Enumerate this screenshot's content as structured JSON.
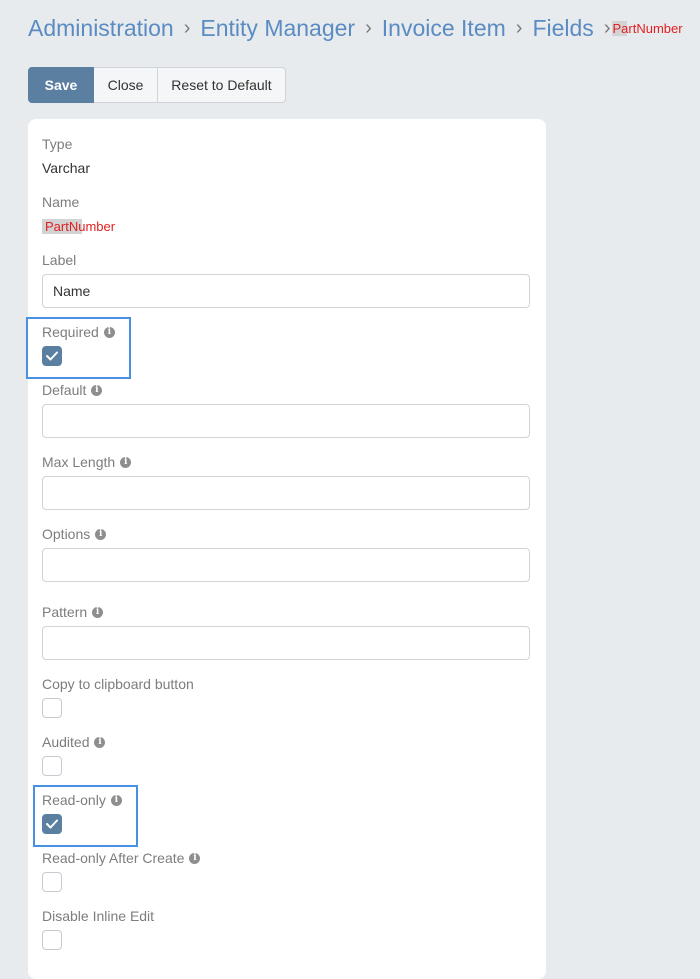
{
  "breadcrumb": {
    "items": [
      "Administration",
      "Entity Manager",
      "Invoice Item",
      "Fields"
    ],
    "current": "PartNumber"
  },
  "toolbar": {
    "save_label": "Save",
    "close_label": "Close",
    "reset_label": "Reset to Default"
  },
  "form": {
    "type": {
      "label": "Type",
      "value": "Varchar"
    },
    "name": {
      "label": "Name",
      "value": "PartNumber"
    },
    "label_field": {
      "label": "Label",
      "value": "Name"
    },
    "required": {
      "label": "Required",
      "checked": true
    },
    "default": {
      "label": "Default",
      "value": ""
    },
    "max_length": {
      "label": "Max Length",
      "value": ""
    },
    "options": {
      "label": "Options",
      "value": ""
    },
    "pattern": {
      "label": "Pattern",
      "value": ""
    },
    "copy_to_clipboard": {
      "label": "Copy to clipboard button",
      "checked": false
    },
    "audited": {
      "label": "Audited",
      "checked": false
    },
    "read_only": {
      "label": "Read-only",
      "checked": true
    },
    "read_only_after_create": {
      "label": "Read-only After Create",
      "checked": false
    },
    "disable_inline_edit": {
      "label": "Disable Inline Edit",
      "checked": false
    }
  },
  "icons": {
    "info": "info-icon",
    "check": "check-icon",
    "chevron": "chevron-right-icon"
  },
  "colors": {
    "accent": "#5b7fa0",
    "link": "#5a8bc2",
    "highlight": "#4a90e2",
    "name_text": "#e02020"
  }
}
